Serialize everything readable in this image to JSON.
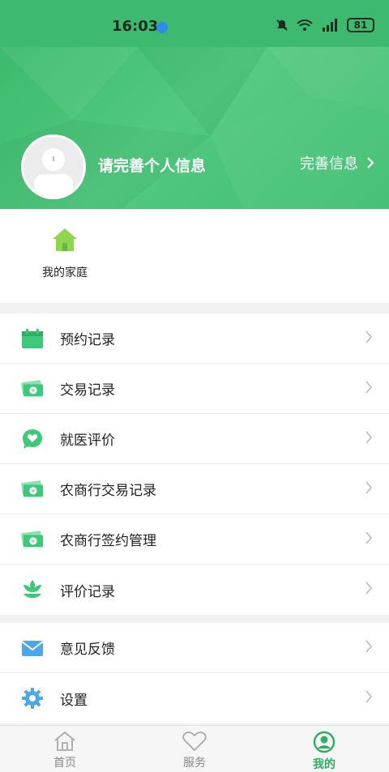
{
  "status_bar": {
    "time": "16:03",
    "battery": "81"
  },
  "profile": {
    "prompt": "请完善个人信息",
    "complete_label": "完善信息"
  },
  "family": {
    "label": "我的家庭"
  },
  "menu_group1": [
    {
      "label": "预约记录",
      "icon": "calendar-icon"
    },
    {
      "label": "交易记录",
      "icon": "money-icon"
    },
    {
      "label": "就医评价",
      "icon": "heart-chat-icon"
    },
    {
      "label": "农商行交易记录",
      "icon": "money-icon"
    },
    {
      "label": "农商行签约管理",
      "icon": "money-icon"
    },
    {
      "label": "评价记录",
      "icon": "lotus-icon"
    }
  ],
  "menu_group2": [
    {
      "label": "意见反馈",
      "icon": "mail-icon"
    },
    {
      "label": "设置",
      "icon": "gear-icon"
    }
  ],
  "tabs": [
    {
      "label": "首页",
      "icon": "home-icon"
    },
    {
      "label": "服务",
      "icon": "heart-icon"
    },
    {
      "label": "我的",
      "icon": "user-icon"
    }
  ],
  "colors": {
    "brand_green": "#3dba6f",
    "active_tab": "#2fae62",
    "icon_green": "#3ec97a",
    "icon_blue": "#4aa8e8"
  }
}
